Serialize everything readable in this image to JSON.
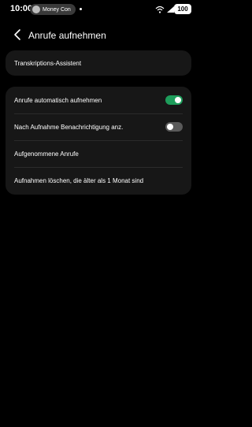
{
  "status_bar": {
    "time": "10:00",
    "notification_app": "Money Con",
    "battery": "100"
  },
  "header": {
    "title": "Anrufe aufnehmen"
  },
  "section1": {
    "items": [
      {
        "label": "Transkriptions-Assistent"
      }
    ]
  },
  "section2": {
    "items": [
      {
        "label": "Anrufe automatisch aufnehmen",
        "toggle": true
      },
      {
        "label": "Nach Aufnahme Benachrichtigung anz.",
        "toggle": false
      },
      {
        "label": "Aufgenommene Anrufe"
      },
      {
        "label": "Aufnahmen löschen, die älter als 1 Monat sind"
      }
    ]
  },
  "colors": {
    "background": "#000000",
    "card": "#171717",
    "toggle_on": "#1e9d5b",
    "toggle_off": "#5a5a5a"
  }
}
